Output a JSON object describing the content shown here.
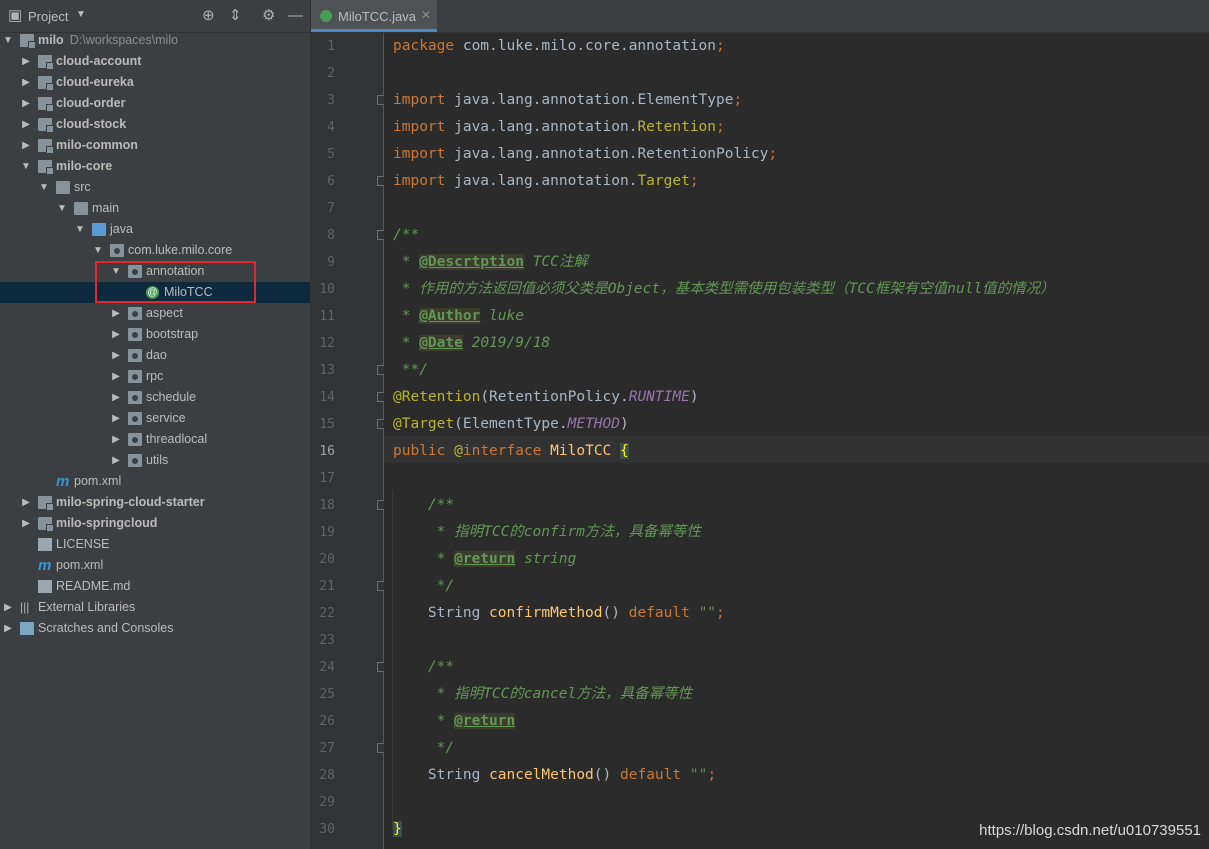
{
  "project_panel": {
    "title": "Project",
    "tree": [
      {
        "label": "milo",
        "sub": "D:\\workspaces\\milo",
        "bold": true,
        "indent": 0,
        "arrow": "down",
        "icon": "module-folder-icon"
      },
      {
        "label": "cloud-account",
        "bold": true,
        "indent": 1,
        "arrow": "right",
        "icon": "module-folder-icon"
      },
      {
        "label": "cloud-eureka",
        "bold": true,
        "indent": 1,
        "arrow": "right",
        "icon": "module-folder-icon"
      },
      {
        "label": "cloud-order",
        "bold": true,
        "indent": 1,
        "arrow": "right",
        "icon": "module-folder-icon"
      },
      {
        "label": "cloud-stock",
        "bold": true,
        "indent": 1,
        "arrow": "right",
        "icon": "module-folder-icon"
      },
      {
        "label": "milo-common",
        "bold": true,
        "indent": 1,
        "arrow": "right",
        "icon": "module-folder-icon"
      },
      {
        "label": "milo-core",
        "bold": true,
        "indent": 1,
        "arrow": "down",
        "icon": "module-folder-icon"
      },
      {
        "label": "src",
        "bold": false,
        "indent": 2,
        "arrow": "down",
        "icon": "folder-icon"
      },
      {
        "label": "main",
        "bold": false,
        "indent": 3,
        "arrow": "down",
        "icon": "folder-icon"
      },
      {
        "label": "java",
        "bold": false,
        "indent": 4,
        "arrow": "down",
        "icon": "source-root-icon"
      },
      {
        "label": "com.luke.milo.core",
        "bold": false,
        "indent": 5,
        "arrow": "down",
        "icon": "package-icon"
      },
      {
        "label": "annotation",
        "bold": false,
        "indent": 6,
        "arrow": "down",
        "icon": "package-icon"
      },
      {
        "label": "MiloTCC",
        "bold": false,
        "indent": 7,
        "arrow": "none",
        "icon": "annotation-file-icon",
        "selected": true
      },
      {
        "label": "aspect",
        "bold": false,
        "indent": 6,
        "arrow": "right",
        "icon": "package-icon"
      },
      {
        "label": "bootstrap",
        "bold": false,
        "indent": 6,
        "arrow": "right",
        "icon": "package-icon"
      },
      {
        "label": "dao",
        "bold": false,
        "indent": 6,
        "arrow": "right",
        "icon": "package-icon"
      },
      {
        "label": "rpc",
        "bold": false,
        "indent": 6,
        "arrow": "right",
        "icon": "package-icon"
      },
      {
        "label": "schedule",
        "bold": false,
        "indent": 6,
        "arrow": "right",
        "icon": "package-icon"
      },
      {
        "label": "service",
        "bold": false,
        "indent": 6,
        "arrow": "right",
        "icon": "package-icon"
      },
      {
        "label": "threadlocal",
        "bold": false,
        "indent": 6,
        "arrow": "right",
        "icon": "package-icon"
      },
      {
        "label": "utils",
        "bold": false,
        "indent": 6,
        "arrow": "right",
        "icon": "package-icon"
      },
      {
        "label": "pom.xml",
        "bold": false,
        "indent": 2,
        "arrow": "none",
        "icon": "maven-icon"
      },
      {
        "label": "milo-spring-cloud-starter",
        "bold": true,
        "indent": 1,
        "arrow": "right",
        "icon": "module-folder-icon"
      },
      {
        "label": "milo-springcloud",
        "bold": true,
        "indent": 1,
        "arrow": "right",
        "icon": "module-folder-icon"
      },
      {
        "label": "LICENSE",
        "bold": false,
        "indent": 1,
        "arrow": "none",
        "icon": "text-file-icon"
      },
      {
        "label": "pom.xml",
        "bold": false,
        "indent": 1,
        "arrow": "none",
        "icon": "maven-icon"
      },
      {
        "label": "README.md",
        "bold": false,
        "indent": 1,
        "arrow": "none",
        "icon": "markdown-file-icon"
      },
      {
        "label": "External Libraries",
        "bold": false,
        "indent": 0,
        "arrow": "right",
        "icon": "library-icon"
      },
      {
        "label": "Scratches and Consoles",
        "bold": false,
        "indent": 0,
        "arrow": "right",
        "icon": "scratches-icon"
      }
    ]
  },
  "editor": {
    "tab_label": "MiloTCC.java",
    "current_line": "16",
    "line_numbers": [
      "1",
      "2",
      "3",
      "4",
      "5",
      "6",
      "7",
      "8",
      "9",
      "10",
      "11",
      "12",
      "13",
      "14",
      "15",
      "16",
      "17",
      "18",
      "19",
      "20",
      "21",
      "22",
      "23",
      "24",
      "25",
      "26",
      "27",
      "28",
      "29",
      "30"
    ]
  },
  "watermark": "https://blog.csdn.net/u010739551"
}
